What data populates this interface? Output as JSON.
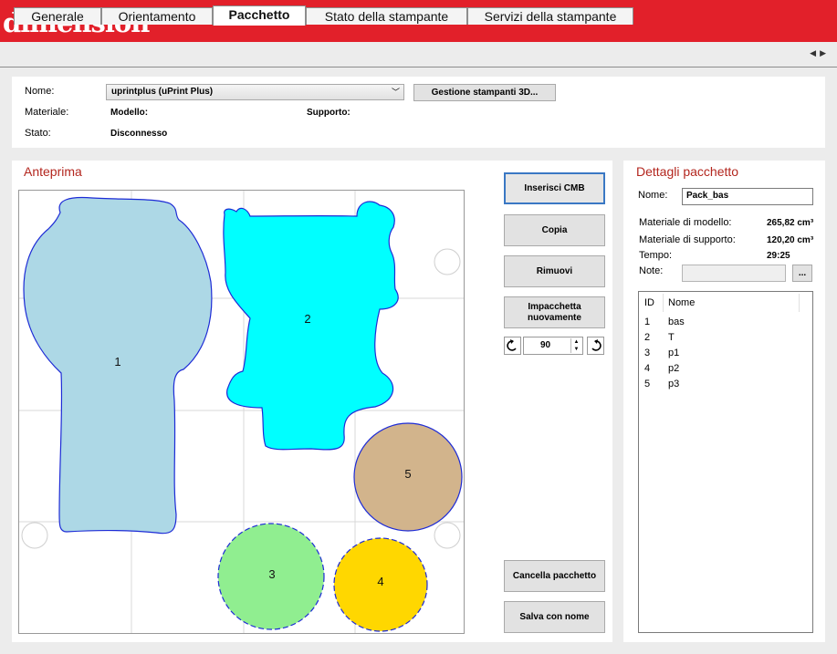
{
  "app": {
    "logo": "dimension"
  },
  "tabs": [
    "Generale",
    "Orientamento",
    "Pacchetto",
    "Stato della stampante",
    "Servizi della stampante"
  ],
  "printer": {
    "name_label": "Nome:",
    "name_value": "uprintplus  (uPrint Plus)",
    "manage_button": "Gestione stampanti 3D...",
    "material_label": "Materiale:",
    "model_label": "Modello:",
    "support_label": "Supporto:",
    "state_label": "Stato:",
    "state_value": "Disconnesso"
  },
  "preview": {
    "title": "Anteprima",
    "parts": [
      {
        "id": "1",
        "color": "#add8e6"
      },
      {
        "id": "2",
        "color": "#00ffff"
      },
      {
        "id": "3",
        "color": "#90ee90"
      },
      {
        "id": "4",
        "color": "#ffd700"
      },
      {
        "id": "5",
        "color": "#d2b48c"
      }
    ]
  },
  "actions": {
    "insert_cmb": "Inserisci CMB",
    "copy": "Copia",
    "remove": "Rimuovi",
    "repack_line1": "Impacchetta",
    "repack_line2": "nuovamente",
    "rotation_value": "90",
    "clear_pack": "Cancella pacchetto",
    "save_as": "Salva con nome"
  },
  "details": {
    "title": "Dettagli pacchetto",
    "name_label": "Nome:",
    "name_value": "Pack_bas",
    "model_material_label": "Materiale di modello:",
    "model_material_value": "265,82 cm³",
    "support_material_label": "Materiale di supporto:",
    "support_material_value": "120,20 cm³",
    "time_label": "Tempo:",
    "time_value": "29:25",
    "notes_label": "Note:",
    "notes_button": "...",
    "columns": [
      "ID",
      "Nome"
    ],
    "rows": [
      {
        "id": "1",
        "name": "bas"
      },
      {
        "id": "2",
        "name": "T"
      },
      {
        "id": "3",
        "name": "p1"
      },
      {
        "id": "4",
        "name": "p2"
      },
      {
        "id": "5",
        "name": "p3"
      }
    ]
  },
  "colors": {
    "brand_red": "#e2202a",
    "title_red": "#b3261e",
    "focus_blue": "#3a78c4"
  }
}
